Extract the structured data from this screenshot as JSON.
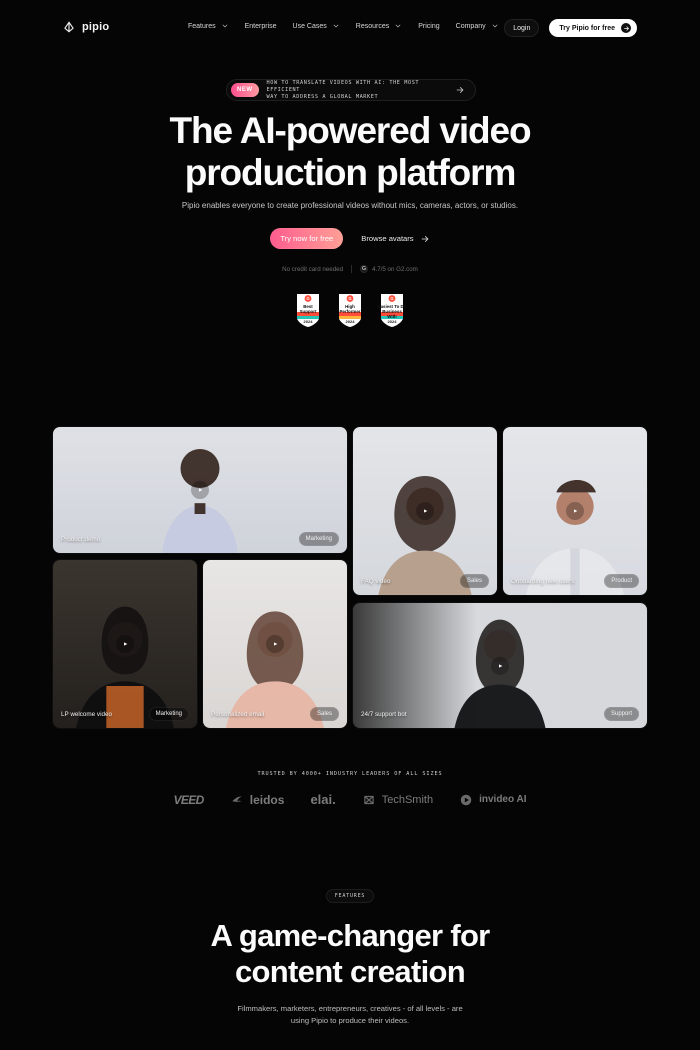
{
  "nav": {
    "brand": "pipio",
    "items": [
      {
        "label": "Features",
        "has_dropdown": true
      },
      {
        "label": "Enterprise",
        "has_dropdown": false
      },
      {
        "label": "Use Cases",
        "has_dropdown": true
      },
      {
        "label": "Resources",
        "has_dropdown": true
      },
      {
        "label": "Pricing",
        "has_dropdown": false
      },
      {
        "label": "Company",
        "has_dropdown": true
      }
    ],
    "login_label": "Login",
    "try_label": "Try Pipio for free"
  },
  "announcement": {
    "badge": "NEW",
    "line1": "HOW TO TRANSLATE VIDEOS WITH AI: THE MOST EFFICIENT",
    "line2": "WAY TO ADDRESS A GLOBAL MARKET"
  },
  "hero": {
    "title_line1": "The AI-powered video",
    "title_line2": "production platform",
    "subtitle": "Pipio enables everyone to create professional videos without mics, cameras, actors, or studios.",
    "cta_primary": "Try now for free",
    "cta_secondary": "Browse avatars",
    "meta_left": "No credit card needed",
    "meta_right": "4.7/5 on G2.com",
    "g2_mark": "G",
    "badges": [
      {
        "text": "Best\nSupport",
        "year": "2024"
      },
      {
        "text": "High\nPerformer",
        "year": "2024"
      },
      {
        "text": "Easiest To Do\nBusiness With",
        "year": "2024"
      }
    ]
  },
  "videos": [
    {
      "title": "Product demo",
      "tag": "Marketing"
    },
    {
      "title": "FAQ video",
      "tag": "Sales"
    },
    {
      "title": "Onboarding new users",
      "tag": "Product"
    },
    {
      "title": "LP welcome video",
      "tag": "Marketing"
    },
    {
      "title": "Personalized email",
      "tag": "Sales"
    },
    {
      "title": "24/7 support bot",
      "tag": "Support"
    }
  ],
  "trusted": {
    "label": "TRUSTED BY 4000+ INDUSTRY LEADERS OF ALL SIZES",
    "logos": [
      "VEED",
      "leidos",
      "elai.",
      "TechSmith",
      "invideo AI"
    ]
  },
  "features": {
    "pill": "FEATURES",
    "title_line1": "A game-changer for",
    "title_line2": "content creation",
    "subtitle_line1": "Filmmakers, marketers, entrepreneurs, creatives - of all levels - are",
    "subtitle_line2": "using Pipio to produce their videos."
  },
  "colors": {
    "background": "#050505",
    "accent_gradient_start": "#ff5c8e",
    "accent_gradient_end": "#ff9f96"
  }
}
